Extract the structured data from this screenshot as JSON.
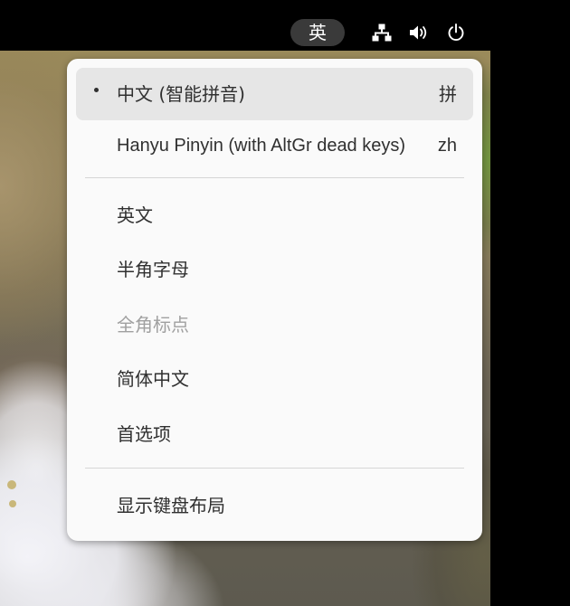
{
  "top_bar": {
    "input_method_indicator": "英",
    "tray_icons": [
      "network-icon",
      "volume-icon",
      "power-icon"
    ]
  },
  "input_method_menu": {
    "engines": [
      {
        "label": "中文 (智能拼音)",
        "accel": "拼",
        "active": true
      },
      {
        "label": "Hanyu Pinyin (with AltGr dead keys)",
        "accel": "zh",
        "active": false
      }
    ],
    "options": [
      {
        "label": "英文",
        "enabled": true
      },
      {
        "label": "半角字母",
        "enabled": true
      },
      {
        "label": "全角标点",
        "enabled": false
      },
      {
        "label": "简体中文",
        "enabled": true
      },
      {
        "label": "首选项",
        "enabled": true
      }
    ],
    "footer": {
      "show_keyboard_layout": "显示键盘布局"
    }
  },
  "colors": {
    "menu_background": "#fafafa",
    "menu_highlight": "#e6e6e6",
    "menu_text": "#303030",
    "menu_text_disabled": "#a0a0a0",
    "top_bar": "#000000",
    "indicator_pill": "#3a3a3a"
  }
}
